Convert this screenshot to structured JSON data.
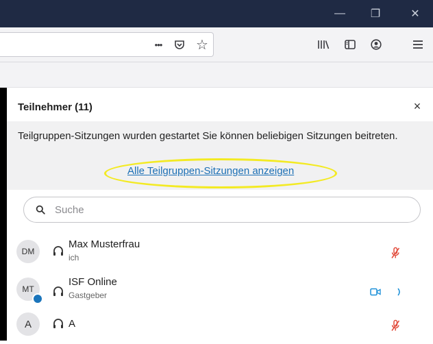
{
  "window": {
    "minimize_glyph": "—",
    "restore_glyph": "❐",
    "close_glyph": "✕"
  },
  "browser": {
    "url_actions": {
      "more_glyph": "•••",
      "pocket_icon": "pocket-icon",
      "bookmark_star_glyph": "☆"
    },
    "toolbar_icons": [
      "library-icon",
      "sidebar-icon",
      "account-icon",
      "menu-icon"
    ]
  },
  "panel": {
    "title": "Teilnehmer (11)",
    "close_glyph": "×",
    "notice": {
      "text": "Teilgruppen-Sitzungen wurden gestartet Sie können beliebigen Sitzungen beitreten.",
      "link": "Alle Teilgruppen-Sitzungen anzeigen"
    },
    "search": {
      "placeholder": "Suche",
      "value": ""
    },
    "participants": [
      {
        "initials": "DM",
        "name": "Max Musterfrau",
        "role": "ich",
        "mic_muted": true
      },
      {
        "initials": "MT",
        "name": "ISF Online",
        "role": "Gastgeber",
        "mic_muted": false,
        "video_on": true
      },
      {
        "initials": "A",
        "name": "A",
        "role": "",
        "mic_muted": true
      }
    ]
  },
  "colors": {
    "titlebar": "#1f2a44",
    "link": "#1b6fb5",
    "highlight": "#f3ea23",
    "muted_mic": "#e24b3b",
    "video_icon": "#1b8fd8",
    "presence_badge": "#1b75bb"
  }
}
